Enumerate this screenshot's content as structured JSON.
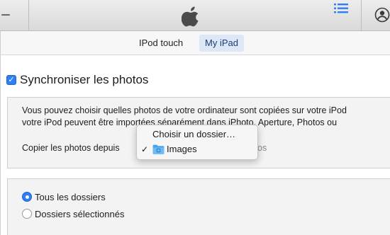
{
  "toolbar": {
    "left_icon": "minus-icon",
    "center_icon": "apple-logo",
    "list_icon": "list-icon",
    "account_icon": "user-icon",
    "accent_color": "#2f7ef3"
  },
  "devices": {
    "tabs": [
      {
        "label": "IPod touch",
        "selected": false
      },
      {
        "label": "My iPad",
        "selected": true
      }
    ]
  },
  "sync": {
    "checked": true,
    "label": "Synchroniser les photos"
  },
  "info": {
    "line1": "Vous pouvez choisir quelles photos de votre ordinateur sont copiées sur votre iPod",
    "line2": "votre iPod peuvent être importées séparément dans iPhoto, Aperture, Photos ou",
    "copy_label": "Copier les photos depuis",
    "copy_suffix": "os"
  },
  "dropdown": {
    "items": [
      {
        "label": "Choisir un dossier…",
        "checked": false
      },
      {
        "label": "Images",
        "checked": true,
        "icon": "folder-icon"
      }
    ],
    "checkmark": "✓"
  },
  "folders": {
    "options": [
      {
        "label": "Tous les dossiers",
        "selected": true
      },
      {
        "label": "Dossiers sélectionnés",
        "selected": false
      }
    ]
  }
}
